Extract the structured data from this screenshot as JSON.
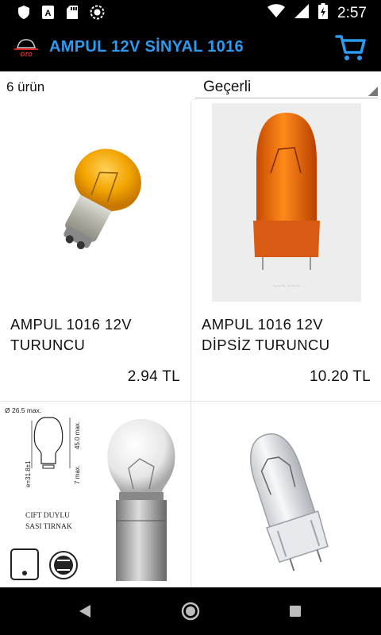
{
  "status_bar": {
    "time": "2:57"
  },
  "app_bar": {
    "title": "AMPUL 12V SİNYAL 1016",
    "logo_text": "OTO"
  },
  "list": {
    "count_label": "6 ürün",
    "sort_value": "Geçerli"
  },
  "products": [
    {
      "name": "AMPUL 1016 12V TURUNCU",
      "price": "2.94 TL"
    },
    {
      "name": "AMPUL 1016 12V DİPSİZ  TURUNCU",
      "price": "10.20 TL"
    },
    {
      "name": "",
      "price": ""
    },
    {
      "name": "",
      "price": ""
    }
  ],
  "diagram": {
    "dim_diameter": "Ø 26.5 max.",
    "dim_height": "45.0 max.",
    "dim_e": "e=31.8±1",
    "dim_base": "7 max.",
    "caption_line1": "CIFT DUYLU",
    "caption_line2": "SASI TIRNAK"
  },
  "colors": {
    "accent": "#2a9bf0",
    "bar": "#000000",
    "amber": "#f2a400"
  },
  "icons": [
    "shield-icon",
    "a-badge-icon",
    "sd-card-icon",
    "sync-icon",
    "wifi-icon",
    "signal-icon",
    "battery-icon",
    "cart-icon",
    "back-icon",
    "home-icon",
    "recents-icon"
  ]
}
